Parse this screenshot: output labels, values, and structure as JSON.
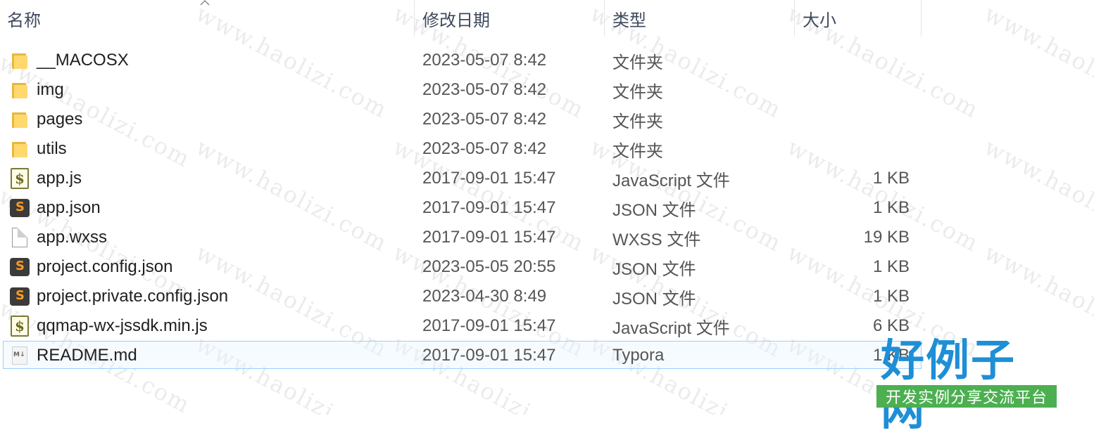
{
  "header": {
    "columns": [
      {
        "key": "name",
        "label": "名称"
      },
      {
        "key": "date",
        "label": "修改日期"
      },
      {
        "key": "type",
        "label": "类型"
      },
      {
        "key": "size",
        "label": "大小"
      }
    ]
  },
  "files": [
    {
      "name": "__MACOSX",
      "date": "2023-05-07 8:42",
      "type": "文件夹",
      "size": "",
      "icon": "folder-icon"
    },
    {
      "name": "img",
      "date": "2023-05-07 8:42",
      "type": "文件夹",
      "size": "",
      "icon": "folder-icon"
    },
    {
      "name": "pages",
      "date": "2023-05-07 8:42",
      "type": "文件夹",
      "size": "",
      "icon": "folder-icon"
    },
    {
      "name": "utils",
      "date": "2023-05-07 8:42",
      "type": "文件夹",
      "size": "",
      "icon": "folder-icon"
    },
    {
      "name": "app.js",
      "date": "2017-09-01 15:47",
      "type": "JavaScript 文件",
      "size": "1 KB",
      "icon": "javascript-file-icon"
    },
    {
      "name": "app.json",
      "date": "2017-09-01 15:47",
      "type": "JSON 文件",
      "size": "1 KB",
      "icon": "json-file-icon"
    },
    {
      "name": "app.wxss",
      "date": "2017-09-01 15:47",
      "type": "WXSS 文件",
      "size": "19 KB",
      "icon": "blank-file-icon"
    },
    {
      "name": "project.config.json",
      "date": "2023-05-05 20:55",
      "type": "JSON 文件",
      "size": "1 KB",
      "icon": "json-file-icon"
    },
    {
      "name": "project.private.config.json",
      "date": "2023-04-30 8:49",
      "type": "JSON 文件",
      "size": "1 KB",
      "icon": "json-file-icon"
    },
    {
      "name": "qqmap-wx-jssdk.min.js",
      "date": "2017-09-01 15:47",
      "type": "JavaScript 文件",
      "size": "6 KB",
      "icon": "javascript-file-icon"
    },
    {
      "name": "README.md",
      "date": "2017-09-01 15:47",
      "type": "Typora",
      "size": "1 KB",
      "icon": "markdown-file-icon",
      "selected": true
    }
  ],
  "watermark": {
    "text": "www.haolizi.com"
  },
  "brand": {
    "title": "好例子网",
    "subtitle": "开发实例分享交流平台"
  }
}
